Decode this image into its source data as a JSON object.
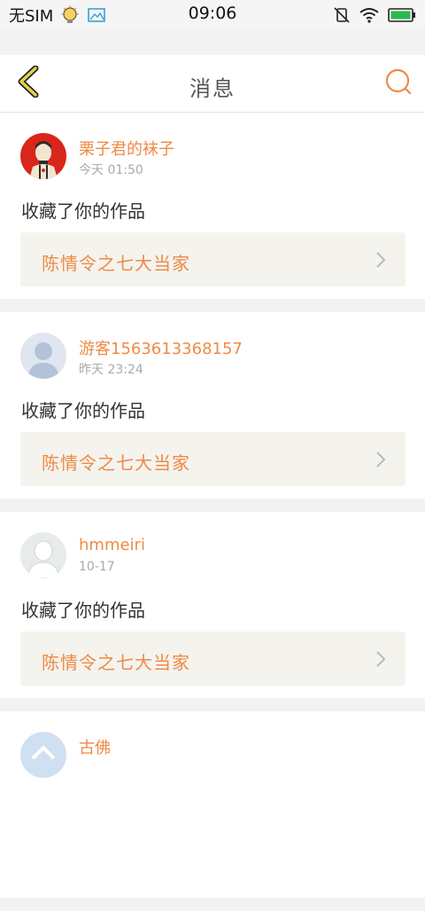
{
  "status_bar": {
    "carrier": "无SIM",
    "time": "09:06",
    "icons": [
      "bulb-icon",
      "image-icon",
      "mute-icon",
      "wifi-icon",
      "battery-icon"
    ]
  },
  "nav": {
    "title": "消息",
    "back_icon": "chevron-left-icon",
    "search_icon": "search-icon"
  },
  "messages": [
    {
      "username": "栗子君的袜子",
      "time": "今天 01:50",
      "action": "收藏了你的作品",
      "work_title": "陈情令之七大当家",
      "avatar": "red-portrait"
    },
    {
      "username": "游客1563613368157",
      "time": "昨天 23:24",
      "action": "收藏了你的作品",
      "work_title": "陈情令之七大当家",
      "avatar": "default-blue"
    },
    {
      "username": "hmmeiri",
      "time": "10-17",
      "action": "收藏了你的作品",
      "work_title": "陈情令之七大当家",
      "avatar": "default-white"
    },
    {
      "username": "古佛",
      "avatar": "partial-blue"
    }
  ],
  "colors": {
    "accent": "#ef8a45",
    "back_icon": "#c8b72c",
    "card_bg": "#ffffff",
    "page_bg": "#f2f2f2",
    "work_bg": "#f4f3ee"
  }
}
